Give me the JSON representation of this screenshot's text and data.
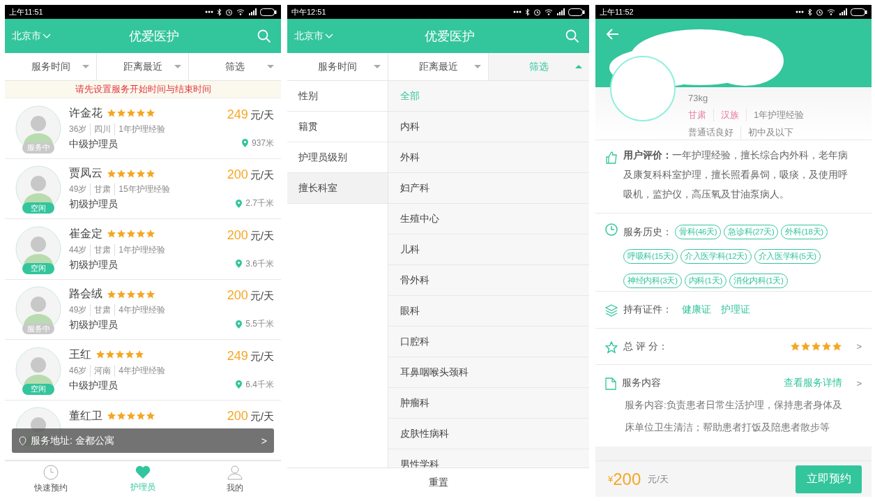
{
  "list_screen": {
    "status_bar": {
      "time": "上午11:51"
    },
    "header": {
      "city": "北京市",
      "title": "优爱医护"
    },
    "filter_tabs": [
      {
        "label": "服务时间",
        "selected": false
      },
      {
        "label": "距离最近",
        "selected": false
      },
      {
        "label": "筛选",
        "selected": false
      }
    ],
    "notice": "请先设置服务开始时间与结束时间",
    "caregivers": [
      {
        "name": "许金花",
        "stars": 5,
        "price": "249",
        "unit": "元/天",
        "age": "36岁",
        "origin": "四川",
        "experience": "1年护理经验",
        "grade": "中级护理员",
        "distance": "937米",
        "status": "服务中",
        "busy": true
      },
      {
        "name": "贾凤云",
        "stars": 5,
        "price": "200",
        "unit": "元/天",
        "age": "49岁",
        "origin": "甘肃",
        "experience": "15年护理经验",
        "grade": "初级护理员",
        "distance": "2.7千米",
        "status": "空闲",
        "busy": false
      },
      {
        "name": "崔金定",
        "stars": 5,
        "price": "200",
        "unit": "元/天",
        "age": "44岁",
        "origin": "甘肃",
        "experience": "1年护理经验",
        "grade": "初级护理员",
        "distance": "3.6千米",
        "status": "空闲",
        "busy": false
      },
      {
        "name": "路会绒",
        "stars": 5,
        "price": "200",
        "unit": "元/天",
        "age": "49岁",
        "origin": "甘肃",
        "experience": "4年护理经验",
        "grade": "初级护理员",
        "distance": "5.5千米",
        "status": "服务中",
        "busy": true
      },
      {
        "name": "王红",
        "stars": 5,
        "price": "249",
        "unit": "元/天",
        "age": "46岁",
        "origin": "河南",
        "experience": "4年护理经验",
        "grade": "中级护理员",
        "distance": "6.4千米",
        "status": "空闲",
        "busy": false
      },
      {
        "name": "董红卫",
        "stars": 5,
        "price": "200",
        "unit": "元/天"
      }
    ],
    "address_bar": {
      "text": "服务地址: 金都公寓",
      "arrow": ">"
    },
    "bottom_nav": [
      {
        "label": "快速预约",
        "selected": false
      },
      {
        "label": "护理员",
        "selected": true
      },
      {
        "label": "我的",
        "selected": false
      }
    ]
  },
  "filter_screen": {
    "status_bar": {
      "time": "中午12:51"
    },
    "header": {
      "city": "北京市",
      "title": "优爱医护"
    },
    "filter_tabs": [
      {
        "label": "服务时间",
        "selected": false
      },
      {
        "label": "距离最近",
        "selected": false
      },
      {
        "label": "筛选",
        "selected": true
      }
    ],
    "categories": [
      {
        "label": "性别",
        "selected": false
      },
      {
        "label": "籍贯",
        "selected": false
      },
      {
        "label": "护理员级别",
        "selected": false
      },
      {
        "label": "擅长科室",
        "selected": true
      }
    ],
    "options": [
      {
        "label": "全部",
        "selected": true
      },
      {
        "label": "内科",
        "selected": false
      },
      {
        "label": "外科",
        "selected": false
      },
      {
        "label": "妇产科",
        "selected": false
      },
      {
        "label": "生殖中心",
        "selected": false
      },
      {
        "label": "儿科",
        "selected": false
      },
      {
        "label": "骨外科",
        "selected": false
      },
      {
        "label": "眼科",
        "selected": false
      },
      {
        "label": "口腔科",
        "selected": false
      },
      {
        "label": "耳鼻咽喉头颈科",
        "selected": false
      },
      {
        "label": "肿瘤科",
        "selected": false
      },
      {
        "label": "皮肤性病科",
        "selected": false
      },
      {
        "label": "男性学科",
        "selected": false
      }
    ],
    "reset_button": "重置"
  },
  "detail_screen": {
    "status_bar": {
      "time": "上午11:52"
    },
    "profile": {
      "weight": "73kg",
      "origin": "甘肃",
      "ethnicity": "汉族",
      "experience": "1年护理经验",
      "language": "普通话良好",
      "education": "初中及以下"
    },
    "review": {
      "label": "用户评价：",
      "text": "一年护理经验，擅长综合内外科，老年病及康复科科室护理，擅长照看鼻饲，吸痰，及使用呼吸机，监护仪，高压氧及甘油泵病人。"
    },
    "history": {
      "label": "服务历史：",
      "tags": [
        "骨科(46天)",
        "急诊科(27天)",
        "外科(18天)",
        "呼吸科(15天)",
        "介入医学科(12天)",
        "介入医学科(5天)",
        "神经内科(3天)",
        "内科(1天)",
        "消化内科(1天)"
      ]
    },
    "certificates": {
      "label": "持有证件：",
      "items": [
        "健康证",
        "护理证"
      ]
    },
    "rating": {
      "label": "总 评 分：",
      "stars": 5,
      "arrow": ">"
    },
    "service": {
      "label": "服务内容",
      "link": "查看服务详情",
      "arrow": ">",
      "description": "服务内容:负责患者日常生活护理，保持患者身体及床单位卫生清洁；帮助患者打饭及陪患者散步等"
    },
    "footer": {
      "currency": "¥",
      "price": "200",
      "unit": "元/天",
      "button": "立即预约"
    }
  }
}
